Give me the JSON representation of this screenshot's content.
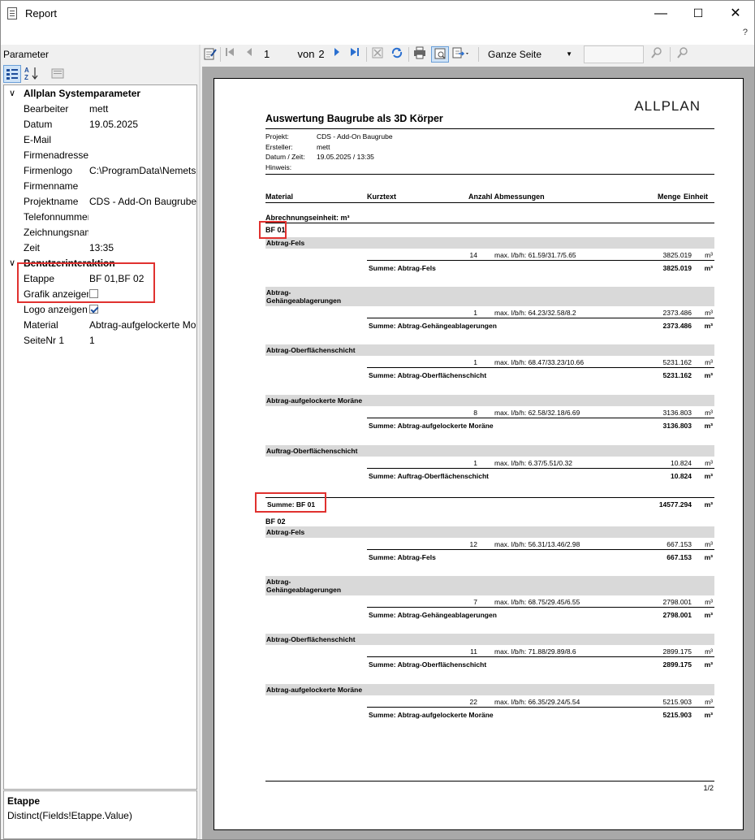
{
  "window": {
    "title": "Report",
    "minimize": "—",
    "maximize": "☐",
    "close": "✕",
    "help": "?"
  },
  "left": {
    "label": "Parameter",
    "categories": [
      {
        "title": "Allplan Systemparameter",
        "rows": [
          {
            "key": "Bearbeiter",
            "value": "mett"
          },
          {
            "key": "Datum",
            "value": "19.05.2025"
          },
          {
            "key": "E-Mail",
            "value": ""
          },
          {
            "key": "Firmenadresse",
            "value": ""
          },
          {
            "key": "Firmenlogo",
            "value": "C:\\ProgramData\\Nemets"
          },
          {
            "key": "Firmenname",
            "value": ""
          },
          {
            "key": "Projektname",
            "value": "CDS - Add-On Baugrube"
          },
          {
            "key": "Telefonnummer",
            "value": ""
          },
          {
            "key": "Zeichnungsname",
            "value": ""
          },
          {
            "key": "Zeit",
            "value": "13:35"
          }
        ]
      },
      {
        "title": "Benutzerinteraktion",
        "rows": [
          {
            "key": "Etappe",
            "value": "BF 01,BF 02"
          },
          {
            "key": "Grafik anzeigen",
            "checkbox": false
          },
          {
            "key": "Logo anzeigen",
            "checkbox": true
          },
          {
            "key": "Material",
            "value": "Abtrag-aufgelockerte Moräne"
          },
          {
            "key": "SeiteNr 1",
            "value": "1"
          }
        ]
      }
    ],
    "description": {
      "title": "Etappe",
      "text": "Distinct(Fields!Etappe.Value)"
    }
  },
  "toolbar": {
    "page": "1",
    "of": "von",
    "total": "2",
    "zoom": "Ganze Seite",
    "search": ""
  },
  "report": {
    "logo": "ALLPLAN",
    "title": "Auswertung Baugrube als 3D Körper",
    "meta": [
      {
        "key": "Projekt:",
        "value": "CDS - Add-On Baugrube"
      },
      {
        "key": "Ersteller:",
        "value": "mett"
      },
      {
        "key": "Datum / Zeit:",
        "value": "19.05.2025  /  13:35"
      },
      {
        "key": "Hinweis:",
        "value": ""
      }
    ],
    "headers": {
      "material": "Material",
      "kurztext": "Kurztext",
      "anzahl": "Anzahl Abmessungen",
      "menge": "Menge",
      "einheit": "Einheit"
    },
    "abrechnung": "Abrechnungseinheit: m³",
    "stages": [
      {
        "name": "BF 01",
        "groups": [
          {
            "title": "Abtrag-Fels",
            "count": "14",
            "dims": "max. l/b/h: 61.59/31.7/5.65",
            "qty": "3825.019",
            "unit": "m³",
            "sum_label": "Summe: Abtrag-Fels",
            "sum": "3825.019"
          },
          {
            "title": "Abtrag-\nGehängeablagerungen",
            "count": "1",
            "dims": "max. l/b/h: 64.23/32.58/8.2",
            "qty": "2373.486",
            "unit": "m³",
            "sum_label": "Summe: Abtrag-Gehängeablagerungen",
            "sum": "2373.486"
          },
          {
            "title": "Abtrag-Oberflächenschicht",
            "count": "1",
            "dims": "max. l/b/h: 68.47/33.23/10.66",
            "qty": "5231.162",
            "unit": "m³",
            "sum_label": "Summe: Abtrag-Oberflächenschicht",
            "sum": "5231.162"
          },
          {
            "title": "Abtrag-aufgelockerte Moräne",
            "count": "8",
            "dims": "max. l/b/h: 62.58/32.18/6.69",
            "qty": "3136.803",
            "unit": "m³",
            "sum_label": "Summe: Abtrag-aufgelockerte Moräne",
            "sum": "3136.803"
          },
          {
            "title": "Auftrag-Oberflächenschicht",
            "count": "1",
            "dims": "max. l/b/h: 6.37/5.51/0.32",
            "qty": "10.824",
            "unit": "m³",
            "sum_label": "Summe: Auftrag-Oberflächenschicht",
            "sum": "10.824"
          }
        ],
        "total_label": "Summe: BF 01",
        "total": "14577.294",
        "total_unit": "m³"
      },
      {
        "name": "BF 02",
        "groups": [
          {
            "title": "Abtrag-Fels",
            "count": "12",
            "dims": "max. l/b/h: 56.31/13.46/2.98",
            "qty": "667.153",
            "unit": "m³",
            "sum_label": "Summe: Abtrag-Fels",
            "sum": "667.153"
          },
          {
            "title": "Abtrag-\nGehängeablagerungen",
            "count": "7",
            "dims": "max. l/b/h: 68.75/29.45/6.55",
            "qty": "2798.001",
            "unit": "m³",
            "sum_label": "Summe: Abtrag-Gehängeablagerungen",
            "sum": "2798.001"
          },
          {
            "title": "Abtrag-Oberflächenschicht",
            "count": "11",
            "dims": "max. l/b/h: 71.88/29.89/8.6",
            "qty": "2899.175",
            "unit": "m³",
            "sum_label": "Summe: Abtrag-Oberflächenschicht",
            "sum": "2899.175"
          },
          {
            "title": "Abtrag-aufgelockerte Moräne",
            "count": "22",
            "dims": "max. l/b/h: 66.35/29.24/5.54",
            "qty": "5215.903",
            "unit": "m³",
            "sum_label": "Summe: Abtrag-aufgelockerte Moräne",
            "sum": "5215.903"
          }
        ]
      }
    ],
    "page_number": "1/2"
  },
  "colors": {
    "highlight": "#e0312f",
    "band": "#d9d9d9",
    "pageBackground": "#a9a9a9",
    "accent": "#1f4e9b"
  }
}
